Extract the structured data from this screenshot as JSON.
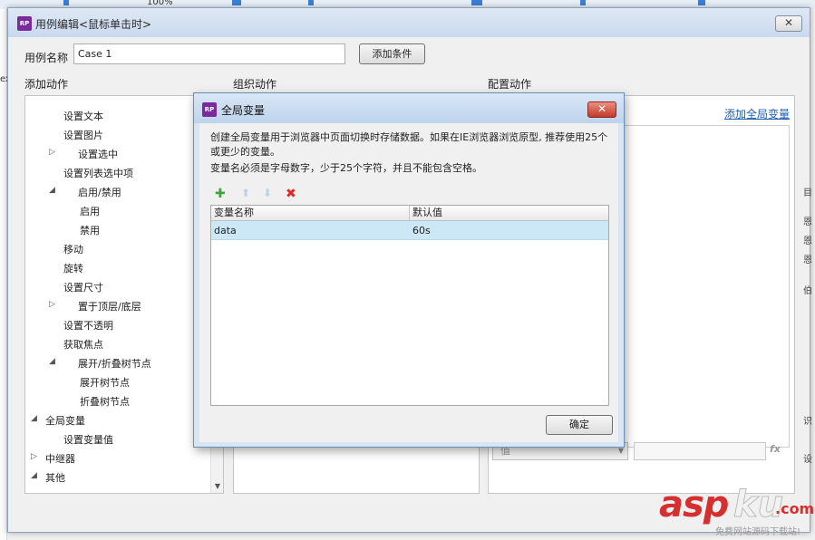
{
  "background": {
    "zoom": "100%",
    "left_text": "ex"
  },
  "main_dialog": {
    "icon_text": "RP",
    "title": "用例编辑<鼠标单击时>",
    "close_glyph": "✕",
    "case_name_label": "用例名称",
    "case_name_value": "Case 1",
    "add_condition_label": "添加条件",
    "columns": {
      "add_action": "添加动作",
      "organize_action": "组织动作",
      "configure_action": "配置动作"
    },
    "action_tree": [
      {
        "label": "设置文本",
        "level": 1,
        "expander": ""
      },
      {
        "label": "设置图片",
        "level": 1,
        "expander": ""
      },
      {
        "label": "设置选中",
        "level": 1,
        "expander": "▷"
      },
      {
        "label": "设置列表选中项",
        "level": 1,
        "expander": ""
      },
      {
        "label": "启用/禁用",
        "level": 1,
        "expander": "◢"
      },
      {
        "label": "启用",
        "level": 2,
        "expander": ""
      },
      {
        "label": "禁用",
        "level": 2,
        "expander": ""
      },
      {
        "label": "移动",
        "level": 1,
        "expander": ""
      },
      {
        "label": "旋转",
        "level": 1,
        "expander": ""
      },
      {
        "label": "设置尺寸",
        "level": 1,
        "expander": ""
      },
      {
        "label": "置于顶层/底层",
        "level": 1,
        "expander": "▷"
      },
      {
        "label": "设置不透明",
        "level": 1,
        "expander": ""
      },
      {
        "label": "获取焦点",
        "level": 1,
        "expander": ""
      },
      {
        "label": "展开/折叠树节点",
        "level": 1,
        "expander": "◢"
      },
      {
        "label": "展开树节点",
        "level": 2,
        "expander": ""
      },
      {
        "label": "折叠树节点",
        "level": 2,
        "expander": ""
      },
      {
        "label": "全局变量",
        "level": 0,
        "expander": "◢"
      },
      {
        "label": "设置变量值",
        "level": 1,
        "expander": ""
      },
      {
        "label": "中继器",
        "level": 0,
        "expander": "▷"
      },
      {
        "label": "其他",
        "level": 0,
        "expander": "◢"
      }
    ],
    "add_global_variable_link": "添加全局变量",
    "value_select": "值",
    "fx_label": "fx",
    "right_edge_chars": [
      "目",
      "恩",
      "恩",
      "恩",
      "伯",
      "识",
      "设"
    ]
  },
  "global_variables_dialog": {
    "icon_text": "RP",
    "title": "全局变量",
    "close_glyph": "✕",
    "description_1": "创建全局变量用于浏览器中页面切换时存储数据。如果在IE浏览器浏览原型, 推荐使用25个或更少的变量。",
    "description_2": "变量名必须是字母数字，少于25个字符，并且不能包含空格。",
    "toolbar": {
      "add_glyph": "✚",
      "up_glyph": "⬆",
      "down_glyph": "⬇",
      "delete_glyph": "✖"
    },
    "table": {
      "columns": [
        "变量名称",
        "默认值"
      ],
      "rows": [
        {
          "name": "data",
          "default": "60s"
        }
      ]
    },
    "ok_label": "确定"
  },
  "watermark": {
    "asp": "asp",
    "ku": "ku",
    "com": ".com",
    "subtitle": "免费网站源码下载站!"
  }
}
